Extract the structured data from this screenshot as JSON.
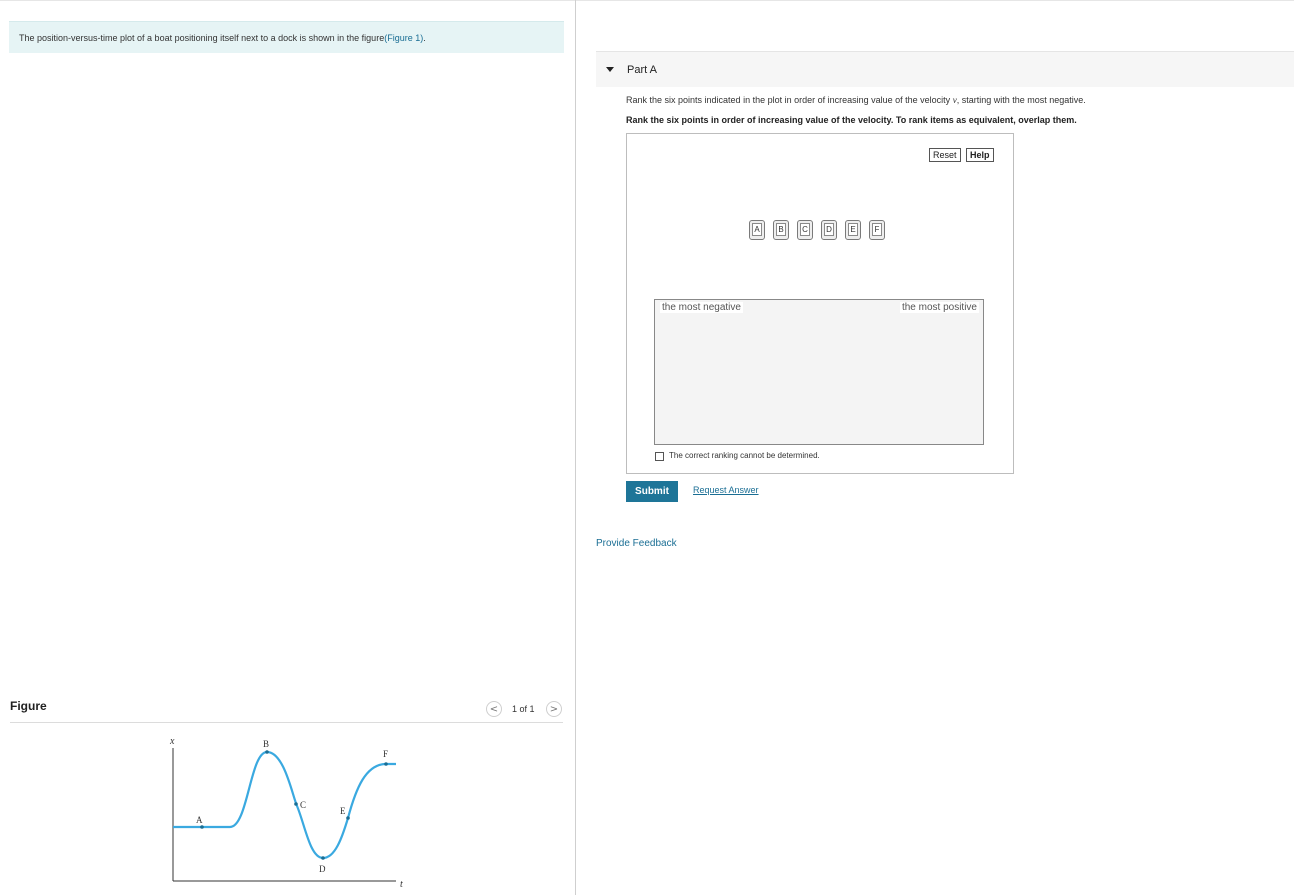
{
  "problem": {
    "intro_text": "The position-versus-time plot of a boat positioning itself next to a dock is shown in the figure",
    "intro_link": "(Figure 1)",
    "intro_end": "."
  },
  "figure": {
    "label": "Figure",
    "pager_text": "1 of 1",
    "prev_glyph": "<",
    "next_glyph": ">",
    "axis_x_label": "x",
    "axis_t_label": "t",
    "points": [
      "A",
      "B",
      "C",
      "D",
      "E",
      "F"
    ],
    "curve_color": "#3aa9e0"
  },
  "part": {
    "title": "Part A",
    "question_pre": "Rank the six points indicated in the plot in order of increasing value of the velocity ",
    "question_var": "v",
    "question_post": ", starting with the most negative.",
    "instruction": "Rank the six points in order of increasing value of the velocity. To rank items as equivalent, overlap them.",
    "reset_label": "Reset",
    "help_label": "Help",
    "tiles": [
      "A",
      "B",
      "C",
      "D",
      "E",
      "F"
    ],
    "drop_label_left": "the most negative",
    "drop_label_right": "the most positive",
    "checkbox_label": "The correct ranking cannot be determined.",
    "submit_label": "Submit",
    "request_answer_label": "Request Answer"
  },
  "feedback_label": "Provide Feedback",
  "colors": {
    "accent": "#1e7598",
    "link": "#1a6e94",
    "intro_bg": "#e6f4f5"
  }
}
